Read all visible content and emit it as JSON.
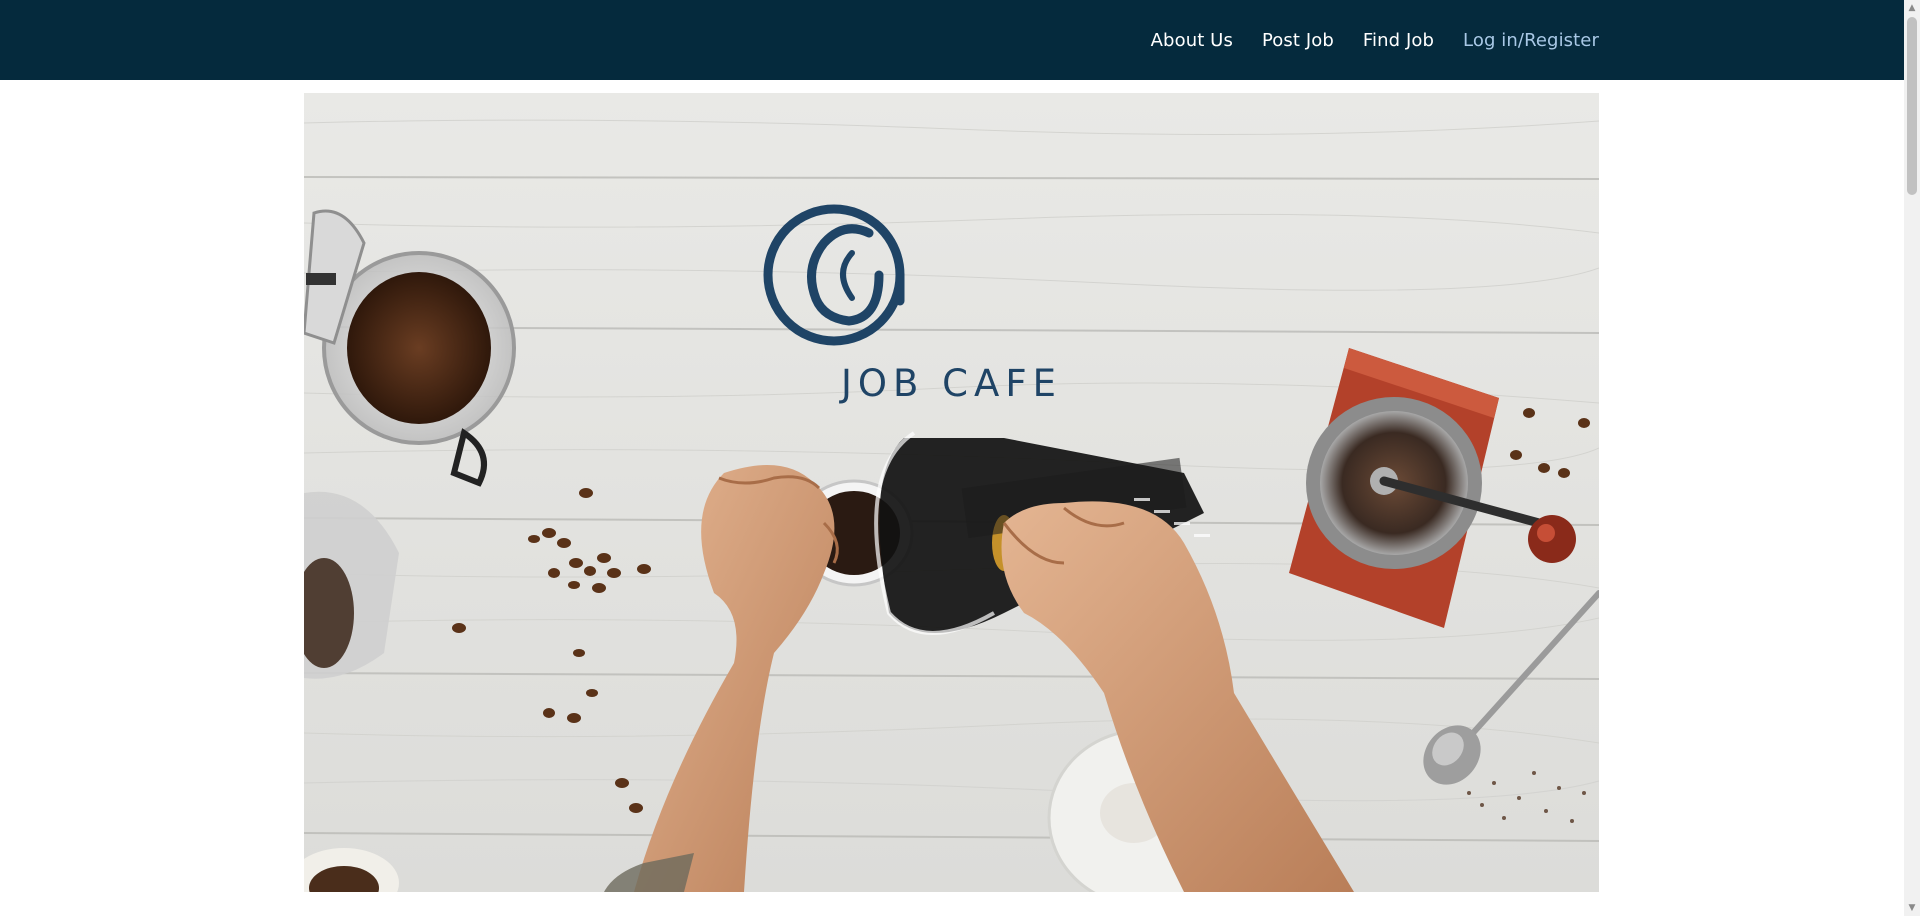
{
  "nav": {
    "about_label": "About Us",
    "post_label": "Post Job",
    "find_label": "Find Job",
    "login_label": "Log in/Register"
  },
  "hero": {
    "logo_text": "JOB CAFE"
  },
  "colors": {
    "header_bg": "#052a3d",
    "login_link": "#a9c8e6",
    "logo_blue": "#1f4466"
  },
  "icons": {
    "scroll_up": "scroll-up-arrow-icon",
    "scroll_down": "scroll-down-arrow-icon",
    "logo": "at-sign-coffee-bean-icon"
  }
}
